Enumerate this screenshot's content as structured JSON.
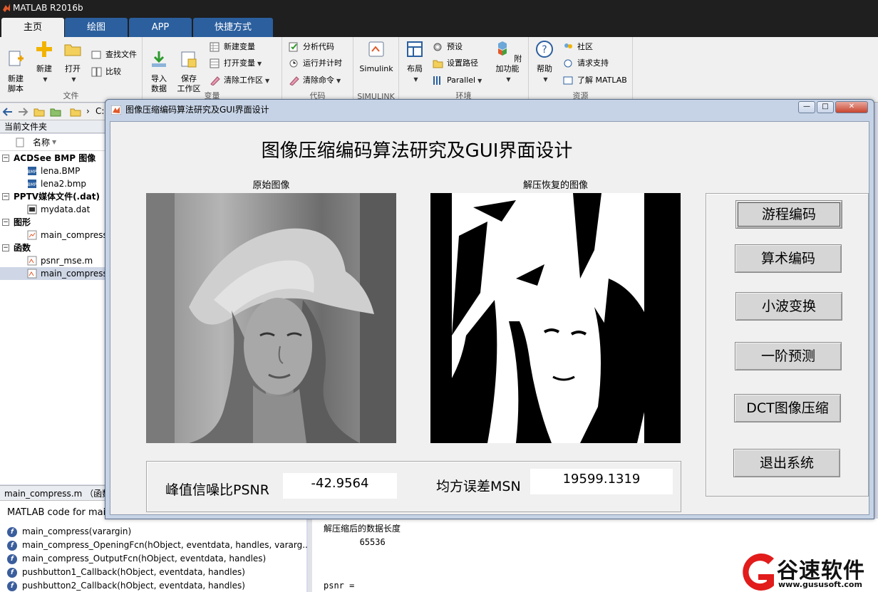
{
  "app": {
    "title": "MATLAB R2016b",
    "tabs": [
      {
        "label": "主页",
        "active": true
      },
      {
        "label": "绘图"
      },
      {
        "label": "APP"
      },
      {
        "label": "快捷方式"
      }
    ]
  },
  "ribbon": {
    "file": {
      "section": "文件",
      "new_script": "新建\n脚本",
      "new": "新建",
      "open": "打开",
      "find_files": "查找文件",
      "compare": "比较"
    },
    "variable": {
      "section": "变量",
      "import": "导入\n数据",
      "save_ws": "保存\n工作区",
      "new_var": "新建变量",
      "open_var": "打开变量",
      "clear_ws": "清除工作区"
    },
    "code": {
      "section": "代码",
      "analyze": "分析代码",
      "run_time": "运行并计时",
      "clear_cmd": "清除命令"
    },
    "simulink": {
      "section": "SIMULINK",
      "label": "Simulink"
    },
    "environment": {
      "section": "环境",
      "layout": "布局",
      "prefs": "预设",
      "set_path": "设置路径",
      "parallel": "Parallel",
      "addons": "附加功能"
    },
    "resources": {
      "section": "资源",
      "help": "帮助",
      "community": "社区",
      "support": "请求支持",
      "learn": "了解 MATLAB"
    }
  },
  "addressbar": {
    "path": "C:"
  },
  "current_folder": {
    "title": "当前文件夹",
    "col_name": "名称",
    "groups": [
      {
        "label": "ACDSee BMP 图像",
        "files": [
          "lena.BMP",
          "lena2.bmp"
        ]
      },
      {
        "label": "PPTV媒体文件(.dat)",
        "files": [
          "mydata.dat"
        ]
      },
      {
        "label": "图形",
        "files": [
          "main_compress"
        ]
      },
      {
        "label": "函数",
        "files": [
          "psnr_mse.m",
          "main_compress"
        ]
      }
    ]
  },
  "details": {
    "title": "main_compress.m （函数",
    "description": "MATLAB code for main",
    "functions": [
      "main_compress(varargin)",
      "main_compress_OpeningFcn(hObject, eventdata, handles, vararg...",
      "main_compress_OutputFcn(hObject, eventdata, handles)",
      "pushbutton1_Callback(hObject, eventdata, handles)",
      "pushbutton2_Callback(hObject, eventdata, handles)"
    ]
  },
  "command_window": {
    "lines": [
      "解压缩后的数据长度",
      "       65536",
      "",
      "",
      "psnr ="
    ]
  },
  "watermark": {
    "brand": "谷速软件",
    "url": "www.gususoft.com"
  },
  "figure": {
    "window_title": "图像压缩编码算法研究及GUI界面设计",
    "heading": "图像压缩编码算法研究及GUI界面设计",
    "original_label": "原始图像",
    "restored_label": "解压恢复的图像",
    "buttons": [
      "游程编码",
      "算术编码",
      "小波变换",
      "一阶预测",
      "DCT图像压缩",
      "退出系统"
    ],
    "psnr_label": "峰值信噪比PSNR",
    "psnr_value": "-42.9564",
    "mse_label": "均方误差MSN",
    "mse_value": "19599.1319"
  }
}
